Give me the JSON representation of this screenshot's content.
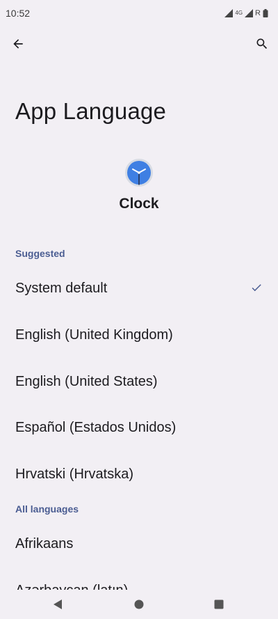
{
  "status_bar": {
    "time": "10:52",
    "network": "4G",
    "roaming": "R"
  },
  "app_bar": {
    "back_icon": "arrow-back-icon",
    "search_icon": "search-icon"
  },
  "page": {
    "title": "App Language",
    "app_icon": "clock-app-icon",
    "app_name": "Clock"
  },
  "suggested": {
    "header": "Suggested",
    "items": [
      {
        "label": "System default",
        "selected": true
      },
      {
        "label": "English (United Kingdom)"
      },
      {
        "label": "English (United States)"
      },
      {
        "label": "Español (Estados Unidos)"
      },
      {
        "label": "Hrvatski (Hrvatska)"
      }
    ]
  },
  "all_languages": {
    "header": "All languages",
    "items": [
      {
        "label": "Afrikaans"
      },
      {
        "label": "Azərbaycan (latın)"
      }
    ]
  },
  "nav_bar": {
    "back": "nav-back-icon",
    "home": "nav-home-icon",
    "recents": "nav-recents-icon"
  },
  "colors": {
    "background": "#f2eff4",
    "accent": "#4b5d92",
    "clock_face": "#3f7fe3"
  }
}
